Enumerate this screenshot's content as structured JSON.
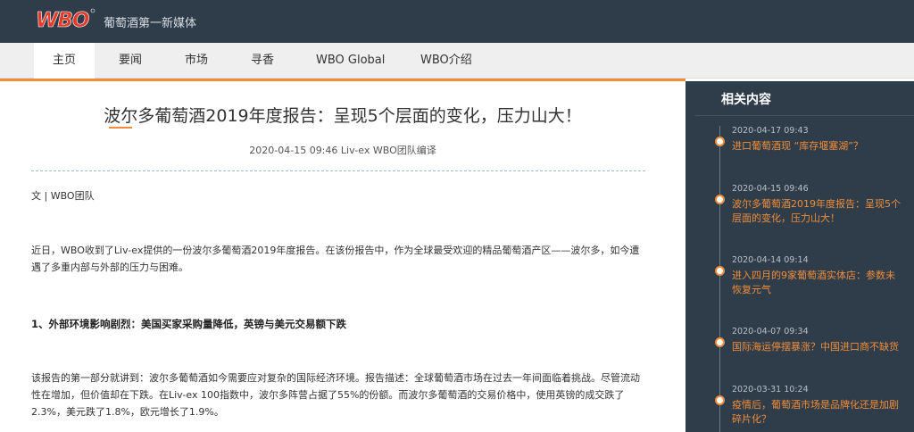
{
  "header": {
    "logo_text": "WBO",
    "tagline": "葡萄酒第一新媒体"
  },
  "nav": {
    "items": [
      "主页",
      "要闻",
      "市场",
      "寻香",
      "WBO Global",
      "WBO介绍"
    ],
    "active": "主页"
  },
  "article": {
    "title": "波尔多葡萄酒2019年度报告：呈现5个层面的变化，压力山大！",
    "meta": "2020-04-15 09:46 Liv-ex WBO团队编译",
    "byline": "文 | WBO团队",
    "intro": "近日，WBO收到了Liv-ex提供的一份波尔多葡萄酒2019年度报告。在该份报告中，作为全球最受欢迎的精品葡萄酒产区——波尔多，如今遭遇了多重内部与外部的压力与困难。",
    "section1_heading": "1、外部环境影响剧烈：美国买家采购量降低，英镑与美元交易额下跌",
    "section1_para": "该报告的第一部分就讲到：波尔多葡萄酒如今需要应对复杂的国际经济环境。报告描述：全球葡萄酒市场在过去一年间面临着挑战。尽管流动性在增加，但价值却在下跌。在Liv-ex 100指数中，波尔多阵营占据了55%的份额。而波尔多葡萄酒的交易价格中，使用英镑的成交跌了2.3%，美元跌了1.8%，欧元增长了1.9%。"
  },
  "sidebar": {
    "title": "相关内容",
    "items": [
      {
        "date": "2020-04-17 09:43",
        "text": "进口葡萄酒现 “库存堰塞湖”？"
      },
      {
        "date": "2020-04-15 09:46",
        "text": "波尔多葡萄酒2019年度报告：呈现5个层面的变化，压力山大！"
      },
      {
        "date": "2020-04-14 09:14",
        "text": "进入四月的9家葡萄酒实体店：参数未恢复元气"
      },
      {
        "date": "2020-04-07 09:34",
        "text": "国际海运停摆暴涨？中国进口商不缺货"
      },
      {
        "date": "2020-03-31 10:24",
        "text": "疫情后，葡萄酒市场是品牌化还是加剧碎片化？"
      }
    ]
  },
  "colors": {
    "header_bg": "#2f3d4a",
    "accent": "#f08d3a",
    "logo_red": "#e33b2a"
  }
}
